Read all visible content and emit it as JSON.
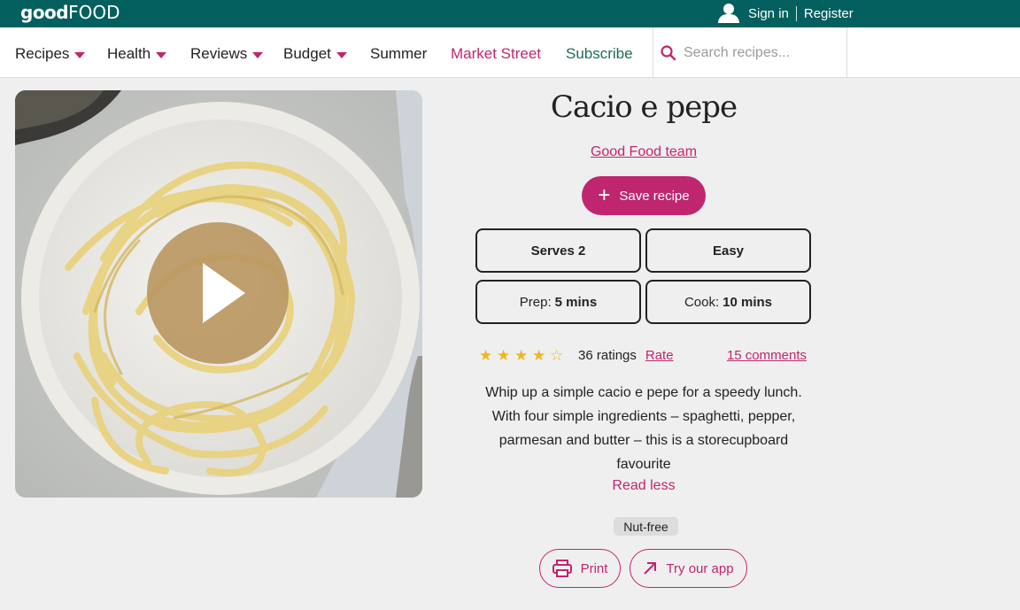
{
  "brand": {
    "logo_good": "good",
    "logo_food": "FOOD"
  },
  "header": {
    "sign_in": "Sign in",
    "register": "Register"
  },
  "nav": {
    "items": [
      {
        "label": "Recipes",
        "has_dropdown": true
      },
      {
        "label": "Health",
        "has_dropdown": true
      },
      {
        "label": "Reviews",
        "has_dropdown": true
      },
      {
        "label": "Budget",
        "has_dropdown": true
      },
      {
        "label": "Summer",
        "has_dropdown": false
      },
      {
        "label": "Market Street",
        "has_dropdown": false
      },
      {
        "label": "Subscribe",
        "has_dropdown": false
      }
    ],
    "search_placeholder": "Search recipes..."
  },
  "recipe": {
    "title": "Cacio e pepe",
    "author": "Good Food team",
    "save_label": "Save recipe",
    "serves": "Serves 2",
    "difficulty": "Easy",
    "prep_label": "Prep:",
    "prep_value": "5 mins",
    "cook_label": "Cook:",
    "cook_value": "10 mins",
    "rating": 4,
    "rating_max": 5,
    "ratings_count": "36 ratings",
    "rate_link": "Rate",
    "comments": "15 comments",
    "description": "Whip up a simple cacio e pepe for a speedy lunch. With four simple ingredients – spaghetti, pepper, parmesan and butter – this is a storecupboard favourite",
    "read_less": "Read less",
    "tag": "Nut-free",
    "print_label": "Print",
    "app_label": "Try our app"
  },
  "colors": {
    "topbar": "#045f5f",
    "accent": "#c0266f",
    "star": "#f2b61d",
    "subscribe": "#1d6a5c"
  }
}
